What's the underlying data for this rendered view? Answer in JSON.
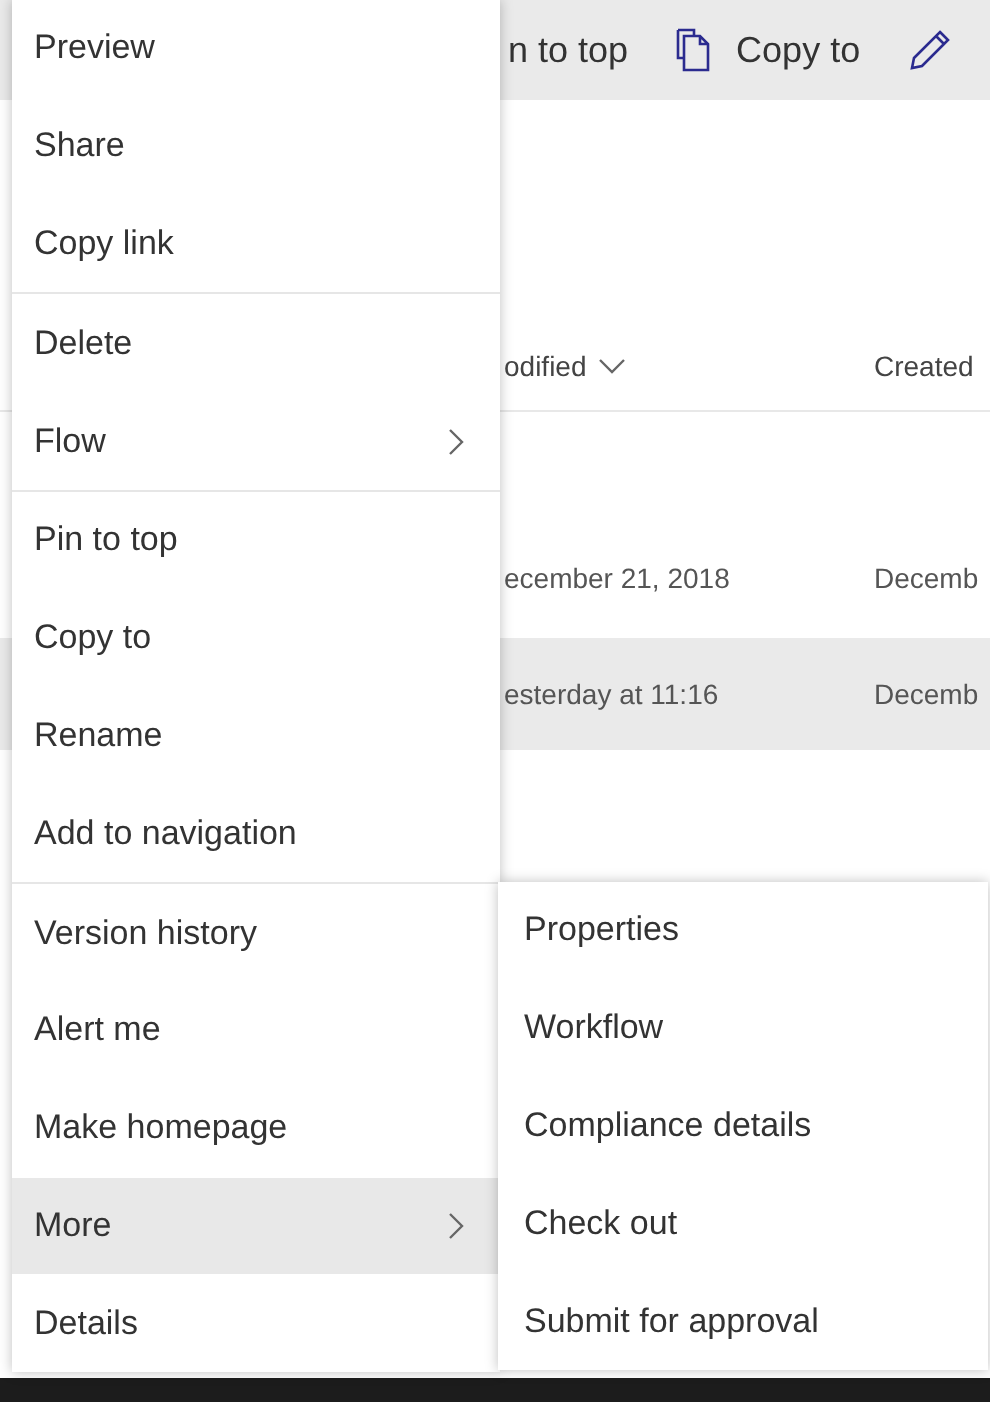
{
  "command_bar": {
    "items": [
      {
        "label": "n to top",
        "kind": "text"
      },
      {
        "label": "Copy to",
        "kind": "copy"
      },
      {
        "kind": "edit"
      }
    ]
  },
  "table": {
    "columns": [
      {
        "label": "odified",
        "sorted": true
      },
      {
        "label": "Created",
        "sorted": false
      }
    ],
    "rows": [
      {
        "cells": [
          "ecember 21, 2018",
          "Decemb"
        ],
        "selected": false
      },
      {
        "cells": [
          "esterday at 11:16",
          "Decemb"
        ],
        "selected": true
      }
    ]
  },
  "context_menu": {
    "groups": [
      [
        {
          "label": "Preview",
          "has_submenu": false,
          "selected": false
        },
        {
          "label": "Share",
          "has_submenu": false,
          "selected": false
        },
        {
          "label": "Copy link",
          "has_submenu": false,
          "selected": false
        }
      ],
      [
        {
          "label": "Delete",
          "has_submenu": false,
          "selected": false
        },
        {
          "label": "Flow",
          "has_submenu": true,
          "selected": false
        }
      ],
      [
        {
          "label": "Pin to top",
          "has_submenu": false,
          "selected": false
        },
        {
          "label": "Copy to",
          "has_submenu": false,
          "selected": false
        },
        {
          "label": "Rename",
          "has_submenu": false,
          "selected": false
        },
        {
          "label": "Add to navigation",
          "has_submenu": false,
          "selected": false
        }
      ],
      [
        {
          "label": "Version history",
          "has_submenu": false,
          "selected": false
        },
        {
          "label": "Alert me",
          "has_submenu": false,
          "selected": false
        },
        {
          "label": "Make homepage",
          "has_submenu": false,
          "selected": false
        },
        {
          "label": "More",
          "has_submenu": true,
          "selected": true
        },
        {
          "label": "Details",
          "has_submenu": false,
          "selected": false
        }
      ]
    ]
  },
  "submenu": {
    "items": [
      {
        "label": "Properties"
      },
      {
        "label": "Workflow"
      },
      {
        "label": "Compliance details"
      },
      {
        "label": "Check out"
      },
      {
        "label": "Submit for approval"
      }
    ]
  }
}
